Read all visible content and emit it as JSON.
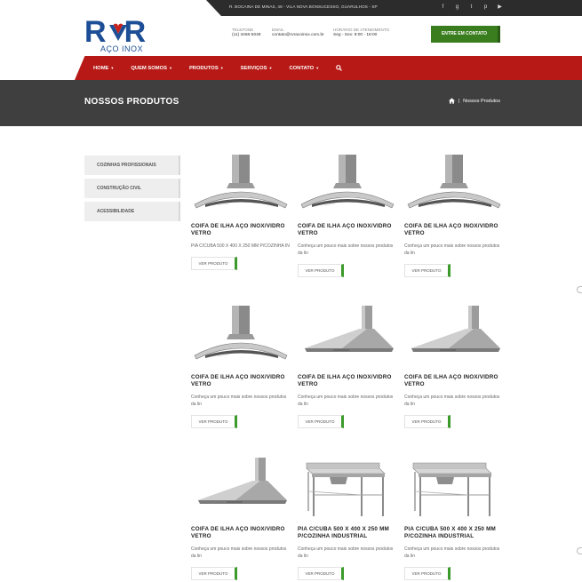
{
  "header": {
    "address": "R. BOCAINA DE MINAS, 48 - VILA NOVA BONSUCESSO, GUARULHOS - SP",
    "social_icons": [
      "facebook-icon",
      "google-plus-icon",
      "twitter-icon",
      "pinterest-icon",
      "youtube-icon"
    ],
    "logo_main": "RVR",
    "logo_sub": "AÇO INOX",
    "phone_label": "TELEFONE",
    "phone": "(11) 3456-5048",
    "email_label": "EMAIL",
    "email": "contato@rvracoinox.com.br",
    "hours_label": "HORÁRIO DE ATENDIMENTO",
    "hours": "Seg - Sex: 8:00 - 18:00",
    "cta_label": "ENTRE EM CONTATO",
    "accent_color": "#3a7d1f",
    "brand_color": "#1e4f96"
  },
  "nav": {
    "color": "#b71a16",
    "items": [
      "HOME",
      "QUEM SOMOS",
      "PRODUTOS",
      "SERVIÇOS",
      "CONTATO"
    ],
    "search_icon": "search-icon"
  },
  "band": {
    "title": "NOSSOS PRODUTOS",
    "breadcrumb_home_icon": "home-icon",
    "breadcrumb_sep": "|",
    "breadcrumb_current": "Nossos Produtos"
  },
  "sidebar": {
    "categories": [
      "COZINHAS PROFISSIONAIS",
      "CONSTRUÇÃO CIVIL",
      "ACESSIBILIDADE"
    ]
  },
  "products": [
    {
      "name": "COIFA DE ILHA AÇO INOX/VIDRO VETRO",
      "desc": "PIA C/CUBA 500 X 400 X 250 MM P/COZINHA IN",
      "button": "VER PRODUTO",
      "image": "glass-hood"
    },
    {
      "name": "COIFA DE ILHA AÇO INOX/VIDRO VETRO",
      "desc": "Conheça um pouco mais sobre nossos produtos da lin",
      "button": "VER PRODUTO",
      "image": "glass-hood"
    },
    {
      "name": "COIFA DE ILHA AÇO INOX/VIDRO VETRO",
      "desc": "Conheça um pouco mais sobre nossos produtos da lin",
      "button": "VER PRODUTO",
      "image": "glass-hood"
    },
    {
      "name": "COIFA DE ILHA AÇO INOX/VIDRO VETRO",
      "desc": "Conheça um pouco mais sobre nossos produtos da lin",
      "button": "VER PRODUTO",
      "image": "glass-hood"
    },
    {
      "name": "COIFA DE ILHA AÇO INOX/VIDRO VETRO",
      "desc": "Conheça um pouco mais sobre nossos produtos da lin",
      "button": "VER PRODUTO",
      "image": "steel-hood"
    },
    {
      "name": "COIFA DE ILHA AÇO INOX/VIDRO VETRO",
      "desc": "Conheça um pouco mais sobre nossos produtos da lin",
      "button": "VER PRODUTO",
      "image": "steel-hood"
    },
    {
      "name": "COIFA DE ILHA AÇO INOX/VIDRO VETRO",
      "desc": "Conheça um pouco mais sobre nossos produtos da lin",
      "button": "VER PRODUTO",
      "image": "steel-hood"
    },
    {
      "name": "PIA C/CUBA 500 X 400 X 250 MM P/COZINHA INDUSTRIAL",
      "desc": "Conheça um pouco mais sobre nossos produtos da lin",
      "button": "VER PRODUTO",
      "image": "sink-table"
    },
    {
      "name": "PIA C/CUBA 500 X 400 X 250 MM P/COZINHA INDUSTRIAL",
      "desc": "Conheça um pouco mais sobre nossos produtos da lin",
      "button": "VER PRODUTO",
      "image": "sink-table"
    }
  ]
}
